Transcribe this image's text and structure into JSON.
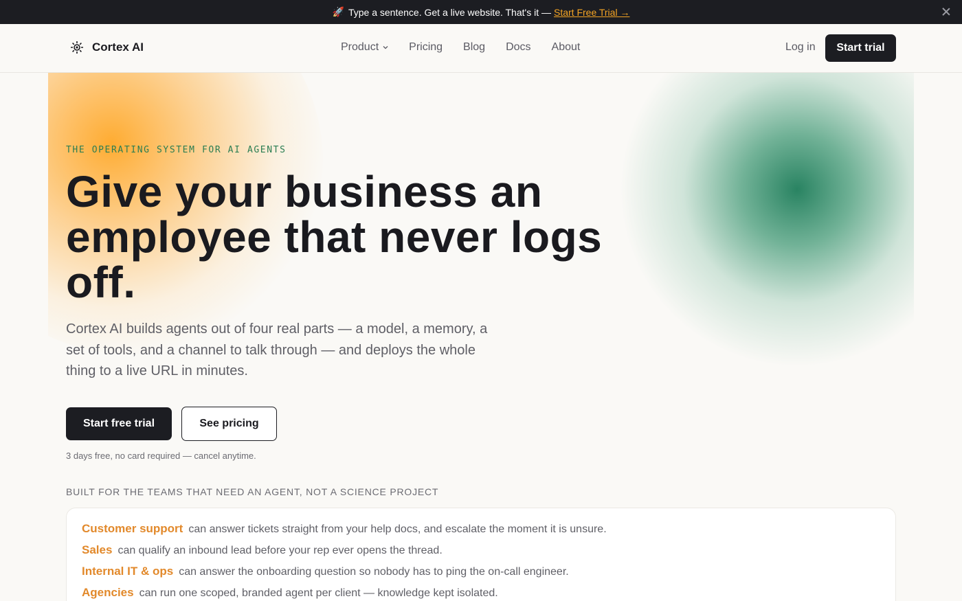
{
  "announcement": {
    "emoji": "🚀",
    "text": "Type a sentence. Get a live website. That's it —",
    "link_label": "Start Free Trial →",
    "close_icon": "close-icon"
  },
  "nav": {
    "brand_name": "Cortex AI",
    "brand_icon": "logo-icon",
    "links": [
      {
        "label": "Product",
        "has_dropdown": true
      },
      {
        "label": "Pricing"
      },
      {
        "label": "Blog"
      },
      {
        "label": "Docs"
      },
      {
        "label": "About"
      }
    ],
    "login_label": "Log in",
    "trial_label": "Start trial"
  },
  "hero": {
    "eyebrow": "THE OPERATING SYSTEM FOR AI AGENTS",
    "headline": "Give your business an employee that never logs off.",
    "subtitle": "Cortex AI builds agents out of four real parts — a model, a memory, a set of tools, and a channel to talk through — and deploys the whole thing to a live URL in minutes.",
    "primary_cta": "Start free trial",
    "secondary_cta": "See pricing",
    "fine_print": "3 days free, no card required — cancel anytime."
  },
  "teams": {
    "label": "BUILT FOR THE TEAMS THAT NEED AN AGENT, NOT A SCIENCE PROJECT",
    "rows": [
      {
        "team": "Customer support",
        "text": "can answer tickets straight from your help docs, and escalate the moment it is unsure."
      },
      {
        "team": "Sales",
        "text": "can qualify an inbound lead before your rep ever opens the thread."
      },
      {
        "team": "Internal IT & ops",
        "text": "can answer the onboarding question so nobody has to ping the on-call engineer."
      },
      {
        "team": "Agencies",
        "text": "can run one scoped, branded agent per client — knowledge kept isolated."
      }
    ]
  },
  "colors": {
    "accent_orange": "#e2892b",
    "accent_green": "#2a7d52",
    "dark": "#1c1d22",
    "background": "#faf9f6"
  }
}
